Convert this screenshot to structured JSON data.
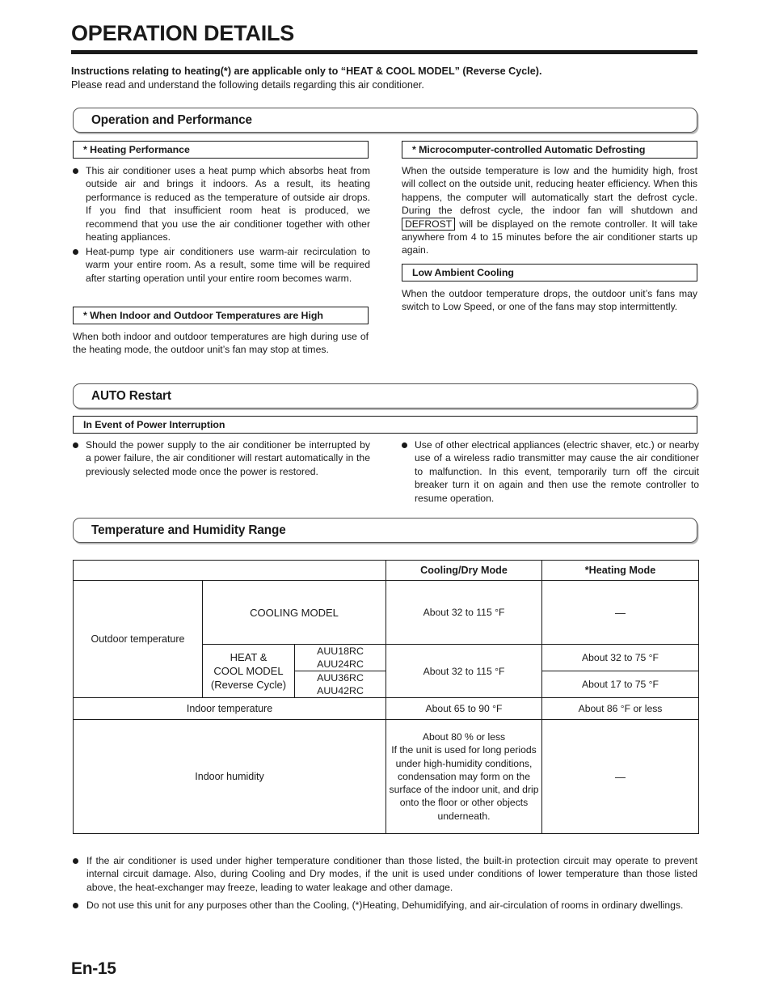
{
  "document": {
    "title": "OPERATION DETAILS",
    "page_number": "En-15",
    "intro_bold": "Instructions relating to heating(*) are applicable only to “HEAT & COOL MODEL” (Reverse Cycle).",
    "intro_normal": "Please read and understand the following details regarding this air conditioner."
  },
  "sections": [
    {
      "id": "operation-and-performance",
      "heading": "Operation and Performance",
      "left_column": {
        "subheads": [
          "* Heating Performance",
          "* When Indoor and Outdoor Temperatures are High"
        ],
        "heating_bullets": [
          "This air conditioner uses a heat pump which absorbs heat from outside air and brings it indoors. As a result, its heating performance is reduced as the temperature of outside air drops. If you find that insufficient room heat is produced, we recommend that you use the air conditioner together with other heating appliances.",
          "Heat-pump type air conditioners use warm-air recirculation to warm your entire room. As a result, some time will be required after starting operation until your entire room becomes warm."
        ],
        "high_temp_text": "When both indoor and outdoor temperatures are high during use of the heating mode, the outdoor unit’s fan may stop at times."
      },
      "right_column": {
        "subheads": [
          "* Microcomputer-controlled Automatic Defrosting",
          "Low Ambient Cooling"
        ],
        "defrost_text_part1": "When the outside temperature is low and the humidity high, frost will collect on the outside unit, reducing heater efficiency. When this happens, the computer will automatically start the defrost cycle. During the defrost cycle, the indoor fan will shutdown and",
        "defrost_boxed_word": "DEFROST",
        "defrost_text_part2": "will be displayed on the remote controller. It will take anywhere from 4 to 15 minutes before the air conditioner starts up again.",
        "low_ambient_text": "When the outdoor temperature drops, the outdoor unit’s fans may switch to Low Speed, or one of the fans may stop intermittently."
      }
    },
    {
      "id": "auto-restart",
      "heading": "AUTO Restart",
      "subhead": "In Event of Power Interruption",
      "bullets": [
        "Should the power supply to the air conditioner be interrupted by a power failure, the air conditioner will restart automatically in the previously selected mode once the power is restored.",
        "Use of other electrical appliances (electric shaver, etc.) or nearby use of a wireless radio transmitter may cause the air conditioner to malfunction. In this event, temporarily turn off the circuit breaker turn it on again and then use the remote controller to resume operation."
      ]
    },
    {
      "id": "temperature-and-humidity-range",
      "heading": "Temperature and Humidity Range"
    }
  ],
  "table": {
    "headers": {
      "blank": "",
      "cooling_dry": "Cooling/Dry Mode",
      "heating": "*Heating Mode"
    },
    "rows": {
      "outdoor_label": "Outdoor temperature",
      "cooling_model_label": "COOLING MODEL",
      "cooling_model_cooling_dry": "About 32 to 115 °F",
      "cooling_model_heating": "—",
      "heat_cool_model_label_line1": "HEAT &",
      "heat_cool_model_label_line2": "COOL MODEL",
      "heat_cool_model_label_line3": "(Reverse Cycle)",
      "codes_group1_line1": "AUU18RC",
      "codes_group1_line2": "AUU24RC",
      "codes_group2_line1": "AUU36RC",
      "codes_group2_line2": "AUU42RC",
      "heat_cool_cooling_dry": "About 32 to 115 °F",
      "heat_cool_heating_group1": "About 32 to 75 °F",
      "heat_cool_heating_group2": "About 17 to 75 °F",
      "indoor_temp_label": "Indoor temperature",
      "indoor_temp_cooling_dry": "About 65 to 90 °F",
      "indoor_temp_heating": "About 86 °F or less",
      "indoor_humidity_label": "Indoor humidity",
      "indoor_humidity_cooling_dry_first": "About 80 % or less",
      "indoor_humidity_cooling_dry_rest": "If the unit is used for long periods under high-humidity conditions, condensation may form on the surface of the indoor unit, and drip onto the floor or other objects underneath.",
      "indoor_humidity_heating": "—"
    }
  },
  "footer_notes": [
    "If the air conditioner is used under higher temperature conditioner than those listed, the built-in protection circuit may operate to prevent internal circuit damage. Also, during Cooling and Dry modes, if the unit is used under conditions of lower temperature than those listed above, the heat-exchanger may freeze, leading to water leakage and other damage.",
    "Do not use this unit for any purposes other than the Cooling, (*)Heating, Dehumidifying, and air-circulation of rooms in ordinary dwellings."
  ]
}
